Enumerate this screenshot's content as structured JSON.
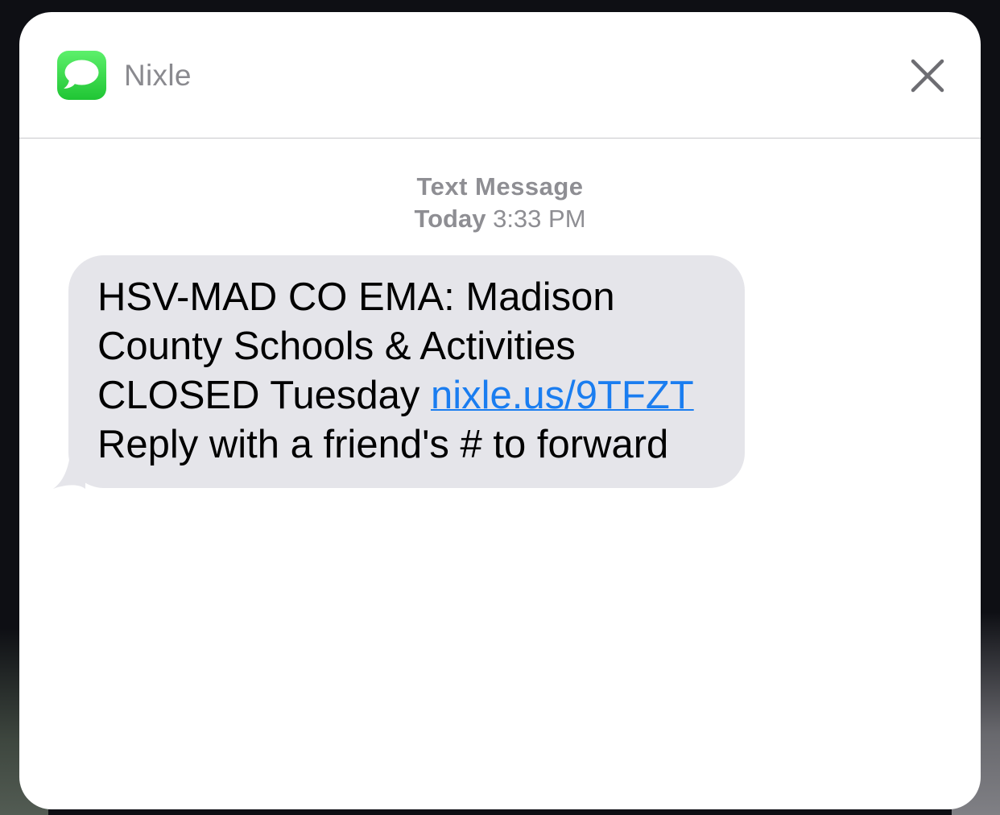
{
  "notification": {
    "app_name": "Nixle",
    "app_icon": "messages-icon",
    "close_icon": "close-icon",
    "message_type": "Text Message",
    "time_day": "Today",
    "time_clock": "3:33 PM",
    "message": {
      "line1": "HSV-MAD CO EMA: Madison",
      "line2": "County Schools & Activities",
      "line3_prefix": "CLOSED Tuesday ",
      "link": "nixle.us/9TFZT",
      "line4": "Reply with a friend's # to forward"
    }
  },
  "colors": {
    "bubble": "#e5e5ea",
    "link": "#1a7df0",
    "icon_green": "#20c534",
    "meta_text": "#8e8e93"
  }
}
